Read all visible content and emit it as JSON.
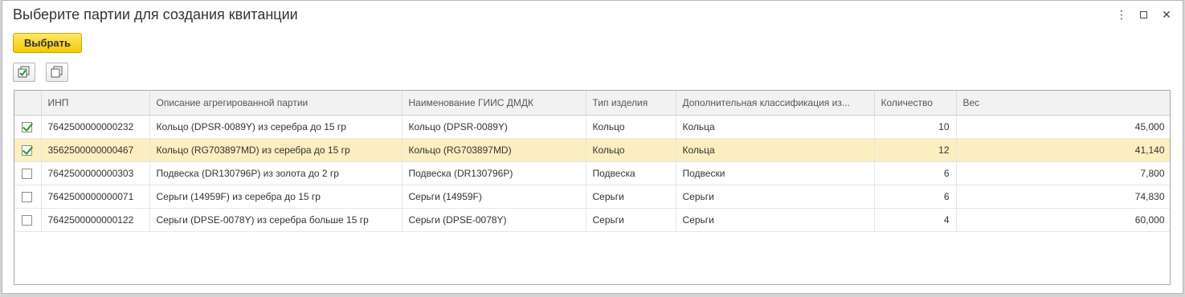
{
  "window": {
    "title": "Выберите партии для создания квитанции",
    "controls": {
      "menu": "⋮",
      "close": "✕"
    }
  },
  "toolbar": {
    "select_label": "Выбрать",
    "check_all_icon": "check-all-icon",
    "uncheck_all_icon": "uncheck-all-icon"
  },
  "table": {
    "columns": [
      "",
      "ИНП",
      "Описание агрегированной партии",
      "Наименование ГИИС ДМДК",
      "Тип изделия",
      "Дополнительная классификация из...",
      "Количество",
      "Вес"
    ],
    "rows": [
      {
        "checked": true,
        "inp": "7642500000000232",
        "description": "Кольцо (DPSR-0089Y) из серебра до 15 гр",
        "giis_name": "Кольцо (DPSR-0089Y)",
        "type": "Кольцо",
        "classification": "Кольца",
        "quantity": "10",
        "weight": "45,000"
      },
      {
        "checked": true,
        "inp": "3562500000000467",
        "description": "Кольцо (RG703897MD) из серебра до 15 гр",
        "giis_name": "Кольцо (RG703897MD)",
        "type": "Кольцо",
        "classification": "Кольца",
        "quantity": "12",
        "weight": "41,140"
      },
      {
        "checked": false,
        "inp": "7642500000000303",
        "description": "Подвеска (DR130796P) из золота до 2 гр",
        "giis_name": "Подвеска (DR130796P)",
        "type": "Подвеска",
        "classification": "Подвески",
        "quantity": "6",
        "weight": "7,800"
      },
      {
        "checked": false,
        "inp": "7642500000000071",
        "description": "Серьги (14959F) из серебра до 15 гр",
        "giis_name": "Серьги (14959F)",
        "type": "Серьги",
        "classification": "Серьги",
        "quantity": "6",
        "weight": "74,830"
      },
      {
        "checked": false,
        "inp": "7642500000000122",
        "description": "Серьги (DPSE-0078Y) из серебра больше 15 гр",
        "giis_name": "Серьги (DPSE-0078Y)",
        "type": "Серьги",
        "classification": "Серьги",
        "quantity": "4",
        "weight": "60,000"
      }
    ],
    "selected_row": 1
  },
  "colors": {
    "accent_button": "#f3c900",
    "selected_row": "#fbeec0",
    "check": "#2b9a2b"
  }
}
